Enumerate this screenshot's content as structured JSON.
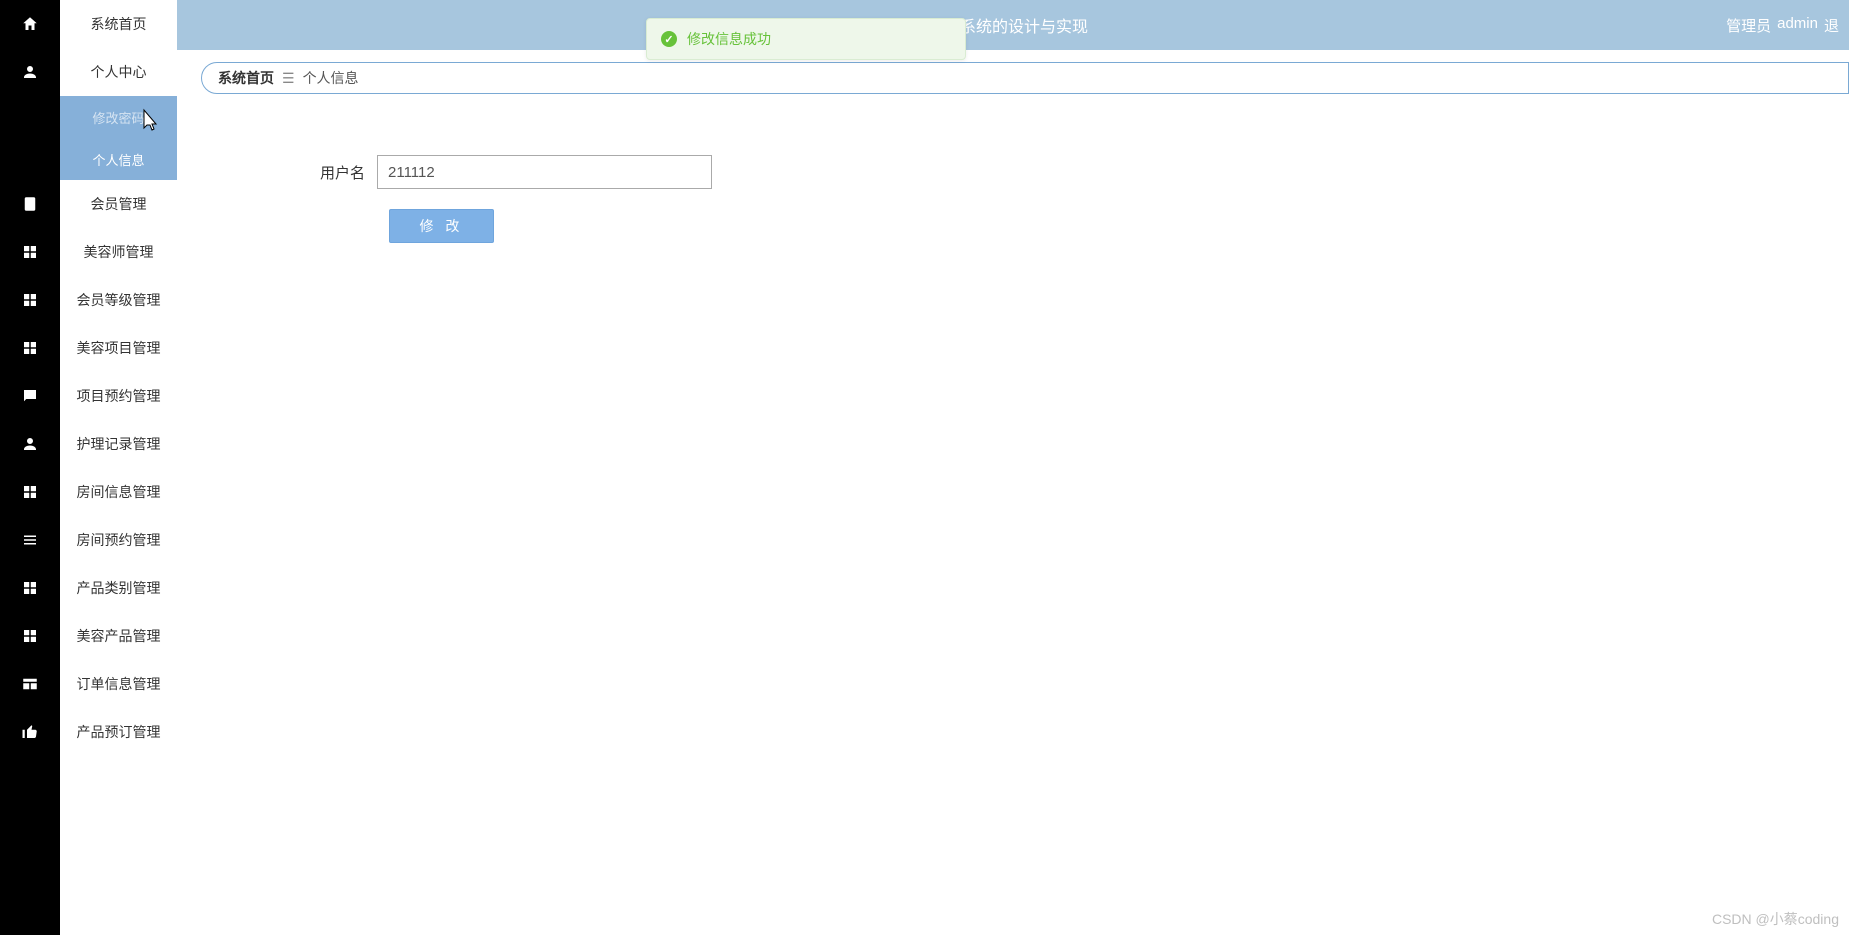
{
  "topbar": {
    "title_suffix": "系统的设计与实现",
    "role_label": "管理员",
    "username": "admin",
    "logout_label": "退"
  },
  "toast": {
    "message": "修改信息成功"
  },
  "breadcrumb": {
    "root": "系统首页",
    "separator": "☰",
    "current": "个人信息"
  },
  "sidebar": {
    "items": [
      {
        "label": "系统首页",
        "icon": "home-icon"
      },
      {
        "label": "个人中心",
        "icon": "user-icon",
        "expanded": true,
        "children": [
          {
            "label": "修改密码",
            "hover": true
          },
          {
            "label": "个人信息",
            "hover": false
          }
        ]
      },
      {
        "label": "会员管理",
        "icon": "clipboard-icon"
      },
      {
        "label": "美容师管理",
        "icon": "grid-icon"
      },
      {
        "label": "会员等级管理",
        "icon": "grid-icon"
      },
      {
        "label": "美容项目管理",
        "icon": "grid-icon"
      },
      {
        "label": "项目预约管理",
        "icon": "chat-icon"
      },
      {
        "label": "护理记录管理",
        "icon": "user-icon"
      },
      {
        "label": "房间信息管理",
        "icon": "grid-icon"
      },
      {
        "label": "房间预约管理",
        "icon": "menu-icon"
      },
      {
        "label": "产品类别管理",
        "icon": "grid-icon"
      },
      {
        "label": "美容产品管理",
        "icon": "grid-icon"
      },
      {
        "label": "订单信息管理",
        "icon": "table-icon"
      },
      {
        "label": "产品预订管理",
        "icon": "thumb-icon"
      }
    ]
  },
  "form": {
    "fields": {
      "username": {
        "label": "用户名",
        "value": "211112"
      }
    },
    "submit_label": "修 改"
  },
  "watermark": "CSDN @小蔡coding"
}
